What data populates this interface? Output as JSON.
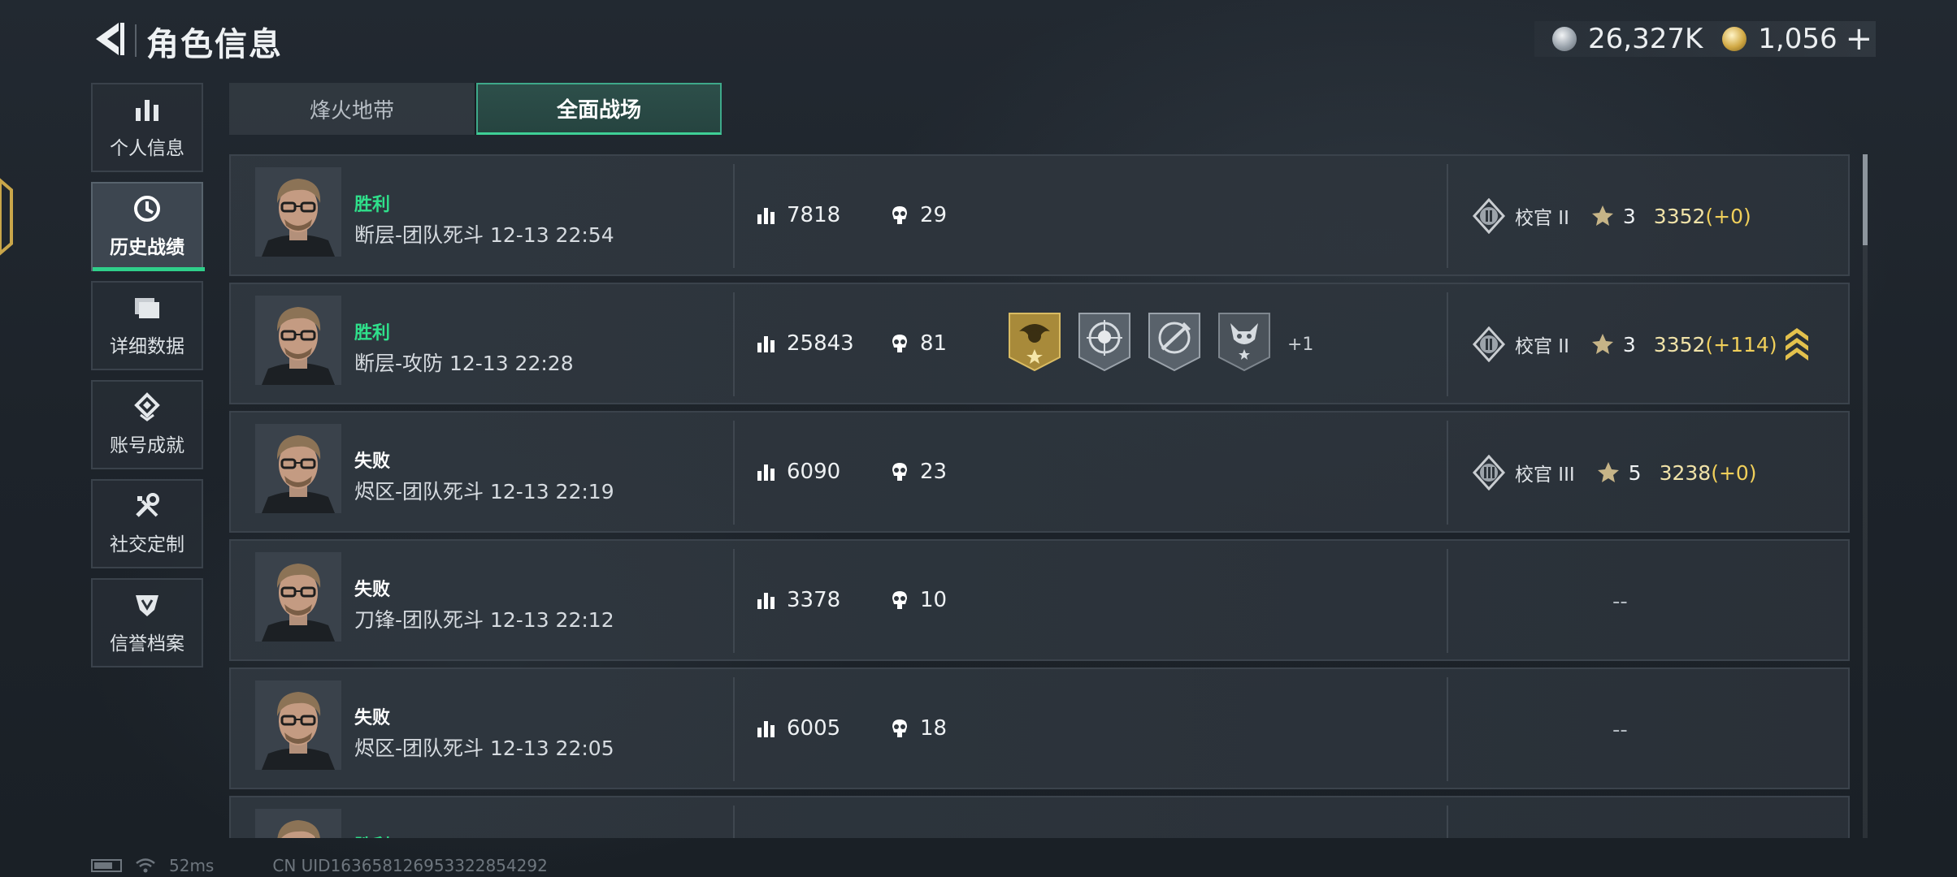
{
  "header": {
    "title": "角色信息",
    "currencies": [
      {
        "icon": "silver-coin-icon",
        "value": "26,327K"
      },
      {
        "icon": "gold-coin-icon",
        "value": "1,056"
      }
    ],
    "add_label": "+"
  },
  "sidebar": {
    "items": [
      {
        "label": "个人信息",
        "icon": "bar-chart-icon",
        "active": false
      },
      {
        "label": "历史战绩",
        "icon": "clock-icon",
        "active": true
      },
      {
        "label": "详细数据",
        "icon": "folder-icon",
        "active": false
      },
      {
        "label": "账号成就",
        "icon": "achievement-icon",
        "active": false
      },
      {
        "label": "社交定制",
        "icon": "tools-icon",
        "active": false
      },
      {
        "label": "信誉档案",
        "icon": "shield-icon",
        "active": false
      }
    ]
  },
  "tabs": [
    {
      "label": "烽火地带",
      "active": false
    },
    {
      "label": "全面战场",
      "active": true
    }
  ],
  "matches": [
    {
      "result": "胜利",
      "win": true,
      "info": "断层-团队死斗 12-13 22:54",
      "score": "7818",
      "kills": "29",
      "rank_name": "校官 II",
      "stars": "3",
      "rank_score": "3352",
      "delta": "(+0)",
      "medals_extra": ""
    },
    {
      "result": "胜利",
      "win": true,
      "info": "断层-攻防 12-13 22:28",
      "score": "25843",
      "kills": "81",
      "rank_name": "校官 II",
      "stars": "3",
      "rank_score": "3352",
      "delta": "(+114)",
      "medals_extra": "+1"
    },
    {
      "result": "失败",
      "win": false,
      "info": "烬区-团队死斗 12-13 22:19",
      "score": "6090",
      "kills": "23",
      "rank_name": "校官 III",
      "stars": "5",
      "rank_score": "3238",
      "delta": "(+0)",
      "medals_extra": ""
    },
    {
      "result": "失败",
      "win": false,
      "info": "刀锋-团队死斗 12-13 22:12",
      "score": "3378",
      "kills": "10",
      "rank_empty": "--"
    },
    {
      "result": "失败",
      "win": false,
      "info": "烬区-团队死斗 12-13 22:05",
      "score": "6005",
      "kills": "18",
      "rank_empty": "--"
    },
    {
      "result": "胜利",
      "win": true,
      "info": "",
      "score": "",
      "kills": ""
    }
  ],
  "footer": {
    "ping": "52ms",
    "uid": "CN UID1636581269533228542​92"
  },
  "colors": {
    "win": "#2fe08b",
    "accent": "#3ecf96",
    "gold_delta": "#f0cf5a"
  }
}
